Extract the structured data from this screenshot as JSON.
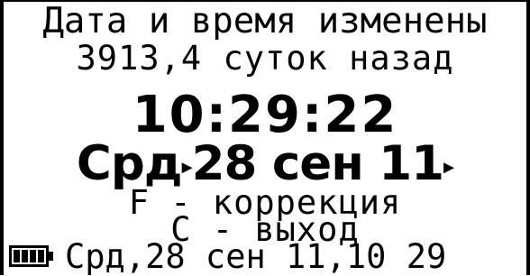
{
  "screen": {
    "header_line1": "Дата и время изменены",
    "header_line2": "3913,4 суток назад",
    "time": "10:29:22",
    "date_weekday": "Срд",
    "date_day": "28",
    "date_month": "сен",
    "date_year": "11",
    "hint_correction": "F - коррекция",
    "hint_exit": "C - выход",
    "status_line": "Срд,28 сен 11,10 29",
    "battery_level": 1.0
  }
}
